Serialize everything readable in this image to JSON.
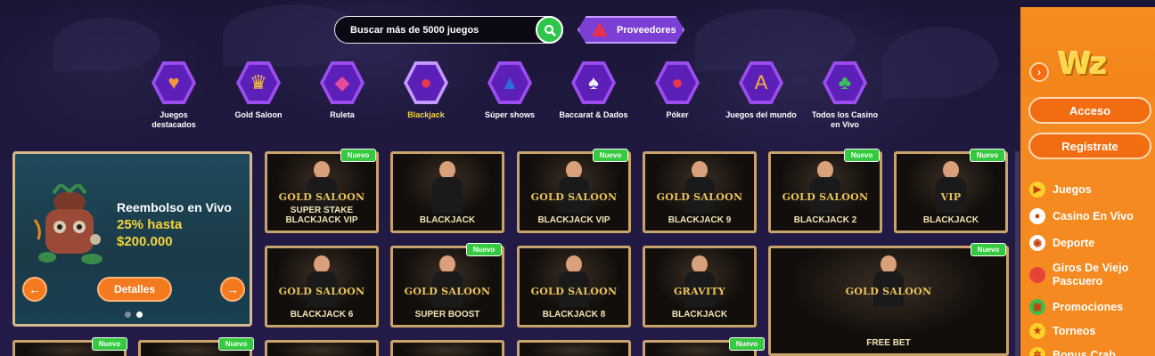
{
  "search": {
    "placeholder": "Buscar más de 5000 juegos"
  },
  "providers_label": "Proveedores",
  "categories": [
    {
      "label": "Juegos destacados",
      "icon": "heart-icon",
      "active": false
    },
    {
      "label": "Gold Saloon",
      "icon": "crown-icon",
      "active": false
    },
    {
      "label": "Ruleta",
      "icon": "diamond-icon",
      "active": false
    },
    {
      "label": "Blackjack",
      "icon": "chips-icon",
      "active": true
    },
    {
      "label": "Súper shows",
      "icon": "top-hat-icon",
      "active": false
    },
    {
      "label": "Baccarat & Dados",
      "icon": "spade-card-icon",
      "active": false
    },
    {
      "label": "Póker",
      "icon": "chips-icon",
      "active": false
    },
    {
      "label": "Juegos del mundo",
      "icon": "letters-icon",
      "active": false
    },
    {
      "label": "Todos los Casino en Vivo",
      "icon": "club-icon",
      "active": false
    }
  ],
  "promo": {
    "title": "Reembolso en Vivo",
    "amount_line1": "25% hasta",
    "amount_line2": "$200.000",
    "button": "Detalles",
    "prev": "←",
    "next": "→"
  },
  "games_row1": [
    {
      "brand": "GOLD SALOON",
      "sub": "SUPER STAKE BLACKJACK VIP",
      "badge": "Nuevo"
    },
    {
      "brand": "",
      "sub": "BLACKJACK",
      "badge": ""
    },
    {
      "brand": "GOLD SALOON",
      "sub": "BLACKJACK VIP",
      "badge": "Nuevo"
    },
    {
      "brand": "GOLD SALOON",
      "sub": "BLACKJACK 9",
      "badge": ""
    },
    {
      "brand": "GOLD SALOON",
      "sub": "BLACKJACK 2",
      "badge": "Nuevo"
    },
    {
      "brand": "VIP",
      "sub": "BLACKJACK",
      "badge": "Nuevo"
    }
  ],
  "games_row2": [
    {
      "brand": "GOLD SALOON",
      "sub": "BLACKJACK 6",
      "badge": ""
    },
    {
      "brand": "GOLD SALOON",
      "sub": "SUPER BOOST",
      "badge": "Nuevo"
    },
    {
      "brand": "GOLD SALOON",
      "sub": "BLACKJACK 8",
      "badge": ""
    },
    {
      "brand": "GRAVITY",
      "sub": "BLACKJACK",
      "badge": ""
    }
  ],
  "big_tile": {
    "brand": "GOLD SALOON",
    "sub": "FREE BET",
    "badge": "Nuevo"
  },
  "row3_badges": [
    "Nuevo",
    "Nuevo",
    "Nuevo"
  ],
  "sidebar": {
    "logo": "Wz",
    "login": "Acceso",
    "register": "Regístrate",
    "items": [
      {
        "label": "Juegos",
        "icon": "play-icon"
      },
      {
        "label": "Casino En Vivo",
        "icon": "poker-chip-icon"
      },
      {
        "label": "Deporte",
        "icon": "soccer-ball-icon"
      },
      {
        "label": "Giros De Viejo Pascuero",
        "icon": "santa-icon"
      },
      {
        "label": "Promociones",
        "icon": "gift-icon"
      },
      {
        "label": "Torneos",
        "icon": "trophy-icon"
      },
      {
        "label": "Bonus Crab",
        "icon": "crab-icon"
      }
    ]
  }
}
